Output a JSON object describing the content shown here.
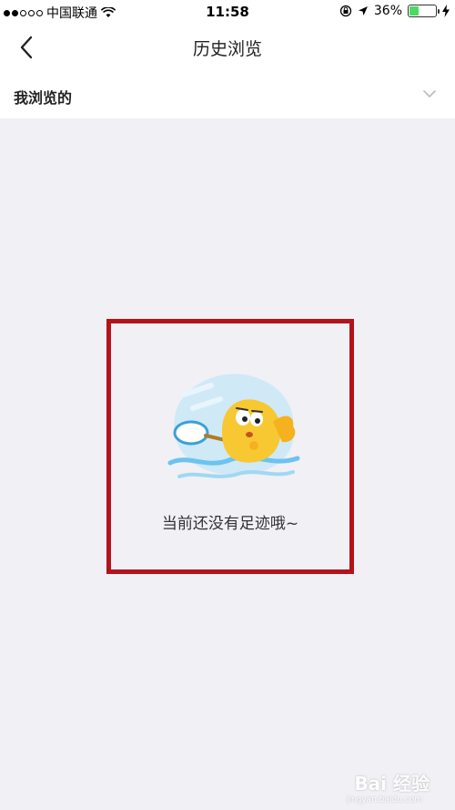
{
  "status_bar": {
    "carrier": "中国联通",
    "time": "11:58",
    "battery": "36%",
    "battery_level": 0.36,
    "icons": [
      "signal-icon",
      "wifi-icon",
      "rotation-lock-icon",
      "location-arrow-icon",
      "battery-icon",
      "charging-icon"
    ]
  },
  "nav": {
    "title": "历史浏览",
    "back_icon": "chevron-left-icon"
  },
  "filter": {
    "selected": "我浏览的",
    "dropdown_icon": "chevron-down-icon"
  },
  "empty_state": {
    "message": "当前还没有足迹哦~",
    "illustration": "fish-with-net-icon",
    "highlight_color": "#b3131a"
  },
  "watermark": {
    "text": "Bai 经验",
    "sub": "jingyan.baidu.com"
  }
}
